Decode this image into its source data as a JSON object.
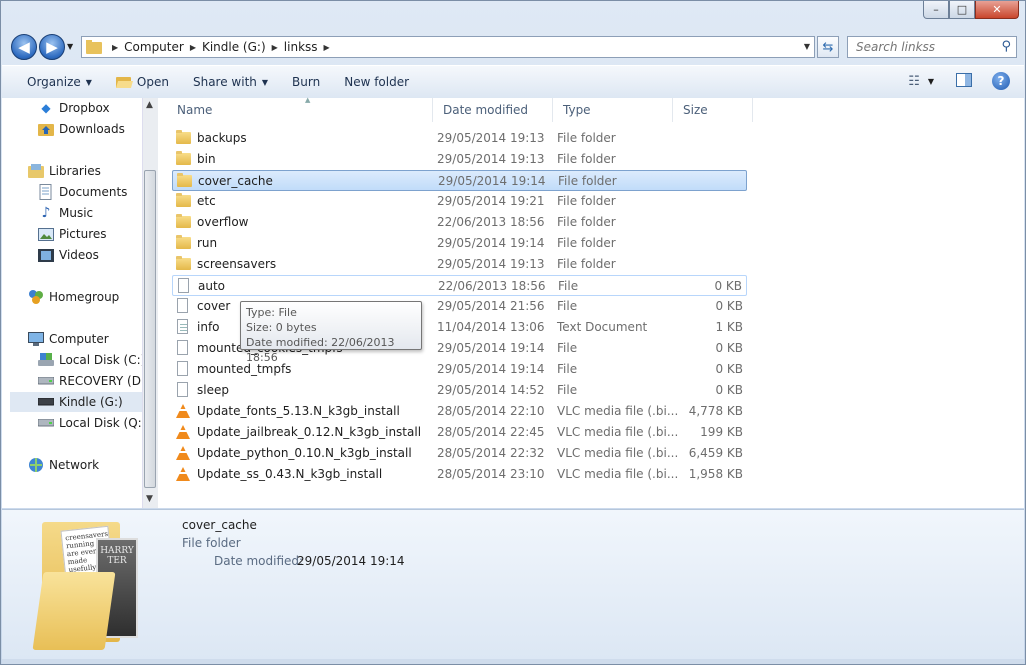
{
  "window": {
    "minimize": "–",
    "maximize": "□",
    "close": "✕"
  },
  "address": {
    "crumbs": [
      "Computer",
      "Kindle (G:)",
      "linkss"
    ]
  },
  "search": {
    "placeholder": "Search linkss"
  },
  "toolbar": {
    "organize": "Organize",
    "open": "Open",
    "share_with": "Share with",
    "burn": "Burn",
    "new_folder": "New folder"
  },
  "nav": {
    "items": [
      {
        "label": "Dropbox",
        "icon": "dropbox-icon"
      },
      {
        "label": "Downloads",
        "icon": "downloads-icon"
      },
      {
        "label": "Libraries",
        "icon": "libraries-icon"
      },
      {
        "label": "Documents",
        "icon": "documents-icon"
      },
      {
        "label": "Music",
        "icon": "music-icon"
      },
      {
        "label": "Pictures",
        "icon": "pictures-icon"
      },
      {
        "label": "Videos",
        "icon": "videos-icon"
      },
      {
        "label": "Homegroup",
        "icon": "homegroup-icon"
      },
      {
        "label": "Computer",
        "icon": "computer-icon"
      },
      {
        "label": "Local Disk (C:)",
        "icon": "local-disk-icon"
      },
      {
        "label": "RECOVERY (D:)",
        "icon": "drive-icon"
      },
      {
        "label": "Kindle (G:)",
        "icon": "drive-icon",
        "selected": true
      },
      {
        "label": "Local Disk (Q:)",
        "icon": "drive-icon"
      },
      {
        "label": "Network",
        "icon": "network-icon"
      }
    ]
  },
  "columns": {
    "name": "Name",
    "date": "Date modified",
    "type": "Type",
    "size": "Size"
  },
  "files": [
    {
      "name": "backups",
      "date": "29/05/2014 19:13",
      "type": "File folder",
      "size": "",
      "kind": "folder"
    },
    {
      "name": "bin",
      "date": "29/05/2014 19:13",
      "type": "File folder",
      "size": "",
      "kind": "folder"
    },
    {
      "name": "cover_cache",
      "date": "29/05/2014 19:14",
      "type": "File folder",
      "size": "",
      "kind": "folder"
    },
    {
      "name": "etc",
      "date": "29/05/2014 19:21",
      "type": "File folder",
      "size": "",
      "kind": "folder"
    },
    {
      "name": "overflow",
      "date": "22/06/2013 18:56",
      "type": "File folder",
      "size": "",
      "kind": "folder"
    },
    {
      "name": "run",
      "date": "29/05/2014 19:14",
      "type": "File folder",
      "size": "",
      "kind": "folder"
    },
    {
      "name": "screensavers",
      "date": "29/05/2014 19:13",
      "type": "File folder",
      "size": "",
      "kind": "folder"
    },
    {
      "name": "auto",
      "date": "22/06/2013 18:56",
      "type": "File",
      "size": "0 KB",
      "kind": "file"
    },
    {
      "name": "cover",
      "date": "29/05/2014 21:56",
      "type": "File",
      "size": "0 KB",
      "kind": "file"
    },
    {
      "name": "info",
      "date": "11/04/2014 13:06",
      "type": "Text Document",
      "size": "1 KB",
      "kind": "doc"
    },
    {
      "name": "mounted_cookies_tmpfs",
      "date": "29/05/2014 19:14",
      "type": "File",
      "size": "0 KB",
      "kind": "file"
    },
    {
      "name": "mounted_tmpfs",
      "date": "29/05/2014 19:14",
      "type": "File",
      "size": "0 KB",
      "kind": "file"
    },
    {
      "name": "sleep",
      "date": "29/05/2014 14:52",
      "type": "File",
      "size": "0 KB",
      "kind": "file"
    },
    {
      "name": "Update_fonts_5.13.N_k3gb_install",
      "date": "28/05/2014 22:10",
      "type": "VLC media file (.bi...",
      "size": "4,778 KB",
      "kind": "vlc"
    },
    {
      "name": "Update_jailbreak_0.12.N_k3gb_install",
      "date": "28/05/2014 22:45",
      "type": "VLC media file (.bi...",
      "size": "199 KB",
      "kind": "vlc"
    },
    {
      "name": "Update_python_0.10.N_k3gb_install",
      "date": "28/05/2014 22:32",
      "type": "VLC media file (.bi...",
      "size": "6,459 KB",
      "kind": "vlc"
    },
    {
      "name": "Update_ss_0.43.N_k3gb_install",
      "date": "28/05/2014 23:10",
      "type": "VLC media file (.bi...",
      "size": "1,958 KB",
      "kind": "vlc"
    }
  ],
  "tooltip": {
    "type": "Type: File",
    "size": "Size: 0 bytes",
    "date": "Date modified: 22/06/2013 18:56"
  },
  "details": {
    "name": "cover_cache",
    "type": "File folder",
    "date_label": "Date modified:",
    "date_value": "29/05/2014 19:14",
    "thumb_page_text": "creensavers running are ever, made usefully were's book ever :)",
    "thumb_book_text": "HARRY TER"
  }
}
